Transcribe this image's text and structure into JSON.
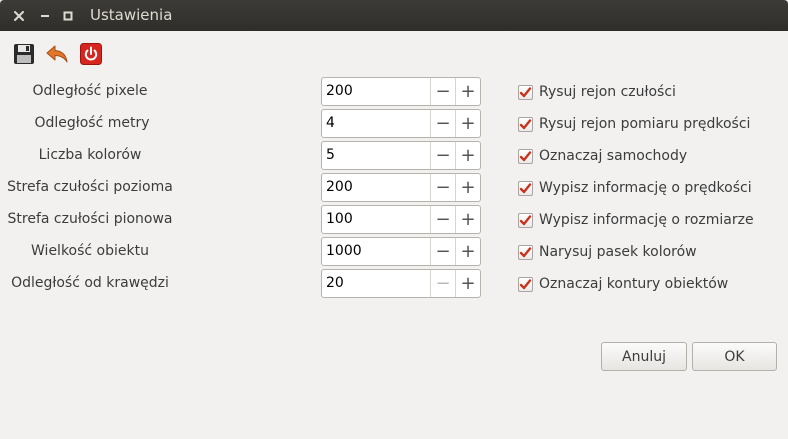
{
  "window": {
    "title": "Ustawienia"
  },
  "toolbar": {
    "icons": [
      "save-icon",
      "undo-icon",
      "power-icon"
    ]
  },
  "settings": [
    {
      "label": "Odległość pixele",
      "value": "200",
      "minus_enabled": true
    },
    {
      "label": "Odległość metry",
      "value": "4",
      "minus_enabled": true
    },
    {
      "label": "Liczba kolorów",
      "value": "5",
      "minus_enabled": true
    },
    {
      "label": "Strefa czułości pozioma",
      "value": "200",
      "minus_enabled": true
    },
    {
      "label": "Strefa czułości pionowa",
      "value": "100",
      "minus_enabled": true
    },
    {
      "label": "Wielkość obiektu",
      "value": "1000",
      "minus_enabled": true
    },
    {
      "label": "Odległość od krawędzi",
      "value": "20",
      "minus_enabled": false
    }
  ],
  "options": [
    {
      "label": "Rysuj rejon czułości",
      "checked": true
    },
    {
      "label": "Rysuj rejon pomiaru prędkości",
      "checked": true
    },
    {
      "label": "Oznaczaj samochody",
      "checked": true
    },
    {
      "label": "Wypisz informację o prędkości",
      "checked": true
    },
    {
      "label": "Wypisz informację o rozmiarze",
      "checked": true
    },
    {
      "label": "Narysuj pasek kolorów",
      "checked": true
    },
    {
      "label": "Oznaczaj kontury obiektów",
      "checked": true
    }
  ],
  "spin_minus_glyph": "−",
  "spin_plus_glyph": "+",
  "buttons": {
    "cancel": "Anuluj",
    "ok": "OK"
  },
  "colors": {
    "check_mark": "#c8341f",
    "power_icon": "#d7261f",
    "undo_icon": "#e0782c"
  }
}
